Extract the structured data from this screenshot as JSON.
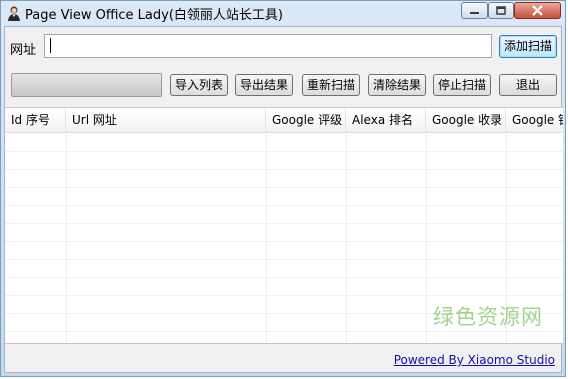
{
  "window": {
    "title": "Page View Office Lady(白领丽人站长工具)",
    "icons": {
      "app": "lady-icon",
      "minimize": "minimize-icon",
      "maximize": "maximize-icon",
      "close": "close-icon"
    }
  },
  "url_bar": {
    "label": "网址",
    "value": "",
    "add_button": "添加扫描"
  },
  "toolbar": {
    "progress": 0,
    "import_list": "导入列表",
    "export_results": "导出结果",
    "rescan": "重新扫描",
    "clear_results": "清除结果",
    "stop_scan": "停止扫描",
    "exit": "退出"
  },
  "table": {
    "columns": [
      "Id 序号",
      "Url 网址",
      "Google 评级",
      "Alexa 排名",
      "Google 收录",
      "Google 锁"
    ],
    "rows": []
  },
  "footer": {
    "powered_by": "Powered By Xiaomo Studio"
  },
  "watermark": "绿色资源网"
}
